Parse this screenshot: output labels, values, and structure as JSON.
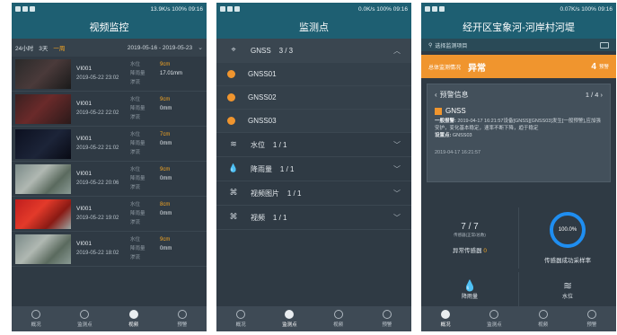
{
  "colors": {
    "header": "#1e5f72",
    "accent": "#f5a623",
    "alarm": "#f0952e",
    "ring": "#1f8ef1"
  },
  "screens": [
    {
      "status": {
        "left": "13.9K/s",
        "right": "100% 09:16"
      },
      "title": "视频监控",
      "filters": [
        "24小时",
        "3天",
        "一周"
      ],
      "selected_filter": "一周",
      "date_range": "2019-05-16 - 2019-05-23",
      "labels": [
        "水位",
        "降雨量",
        "渗流"
      ],
      "videos": [
        {
          "name": "VI001",
          "time": "2019-05-22 23:02",
          "water": "9cm",
          "rain": "17.01mm",
          "thumb": "dark"
        },
        {
          "name": "VI001",
          "time": "2019-05-22 22:02",
          "water": "9cm",
          "rain": "0mm",
          "thumb": "red"
        },
        {
          "name": "VI001",
          "time": "2019-05-22 21:02",
          "water": "7cm",
          "rain": "0mm",
          "thumb": "night"
        },
        {
          "name": "VI001",
          "time": "2019-05-22 20:06",
          "water": "9cm",
          "rain": "0mm",
          "thumb": "river"
        },
        {
          "name": "VI001",
          "time": "2019-05-22 19:02",
          "water": "8cm",
          "rain": "0mm",
          "thumb": "redriver"
        },
        {
          "name": "VI001",
          "time": "2019-05-22 18:02",
          "water": "9cm",
          "rain": "0mm",
          "thumb": "river"
        }
      ],
      "nav": [
        "概况",
        "监测点",
        "视频",
        "预警"
      ],
      "nav_active": 2
    },
    {
      "status": {
        "left": "0.0K/s",
        "right": "100% 09:16"
      },
      "title": "监测点",
      "groups": [
        {
          "icon": "satellite-icon",
          "glyph": "⌖",
          "name": "GNSS",
          "count": "3 / 3",
          "open": true,
          "items": [
            "GNSS01",
            "GNSS02",
            "GNSS03"
          ]
        },
        {
          "icon": "water-level-icon",
          "glyph": "≋",
          "name": "水位",
          "count": "1 / 1",
          "open": false,
          "items": []
        },
        {
          "icon": "rainfall-icon",
          "glyph": "💧",
          "name": "降雨量",
          "count": "1 / 1",
          "open": false,
          "items": []
        },
        {
          "icon": "camera-icon",
          "glyph": "⌘",
          "name": "视频图片",
          "count": "1 / 1",
          "open": false,
          "items": []
        },
        {
          "icon": "video-camera-icon",
          "glyph": "⌘",
          "name": "视频",
          "count": "1 / 1",
          "open": false,
          "items": []
        }
      ],
      "nav": [
        "概况",
        "监测点",
        "视频",
        "预警"
      ],
      "nav_active": 1
    },
    {
      "status": {
        "left": "0.07K/s",
        "right": "100% 09:16"
      },
      "title": "经开区宝象河-河岸村河堤",
      "project_select": "选择监测项目",
      "overall_label": "总体监测情况",
      "overall_state": "异常",
      "overall_count": "4",
      "overall_unit": "预警",
      "alarm": {
        "title": "预警信息",
        "page": "1 / 4",
        "source": "GNSS",
        "level": "一般报警:",
        "message": "2019-04-17 16:21:57设备[GNSS][GNSS03]发生[一般预警],应加强安护，变化基本稳定，速率不断下降，趋于稳定",
        "device_label": "设置点:",
        "device": "GNSS03",
        "time": "2019-04-17 16:21:57"
      },
      "sensors": {
        "value": "7 / 7",
        "sub": "传感器(正常/总数)",
        "label_prefix": "异常传感器",
        "abnormal": "0"
      },
      "rate": {
        "percent": "100.0%",
        "label": "传感器成功采样率"
      },
      "tiles": [
        {
          "icon": "rainfall-icon",
          "glyph": "💧",
          "label": "降雨量"
        },
        {
          "icon": "water-level-icon",
          "glyph": "≋",
          "label": "水位"
        }
      ],
      "nav": [
        "概况",
        "监测点",
        "视频",
        "预警"
      ],
      "nav_active": 0
    }
  ]
}
